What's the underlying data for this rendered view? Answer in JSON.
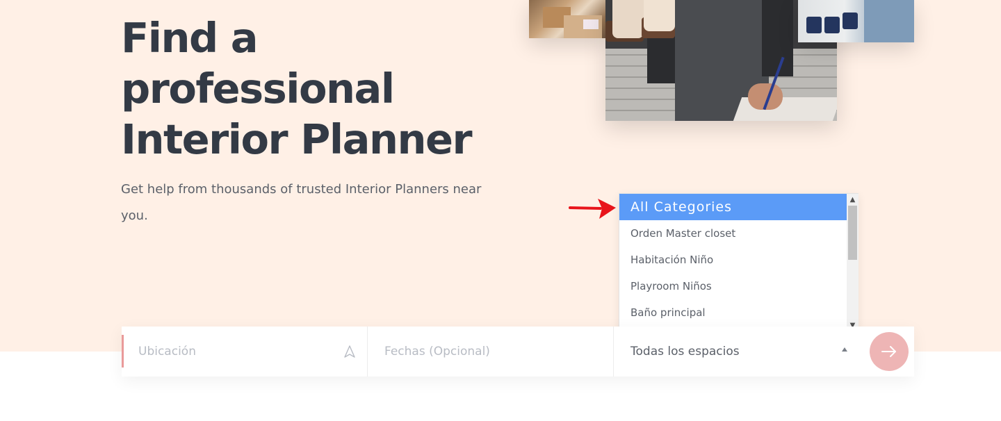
{
  "hero": {
    "title": "Find a professional Interior Planner",
    "subtitle": "Get help from thousands of trusted Interior Planners near you."
  },
  "dropdown": {
    "options": [
      "All Categories",
      "Orden Master closet",
      "Habitación Niño",
      "Playroom Niños",
      "Baño principal"
    ],
    "selected_index": 0,
    "scroll_up_glyph": "▲",
    "scroll_down_glyph": "▼"
  },
  "search": {
    "location_placeholder": "Ubicación",
    "dates_placeholder": "Fechas (Opcional)",
    "space_value": "Todas los espacios",
    "location_icon": "navigation-icon",
    "submit_icon": "arrow-right-icon"
  },
  "colors": {
    "hero_background": "#fff0e6",
    "title_text": "#333a45",
    "dropdown_selected": "#5b9bf7",
    "accent_pink": "#e99a9a",
    "submit_button": "#eeb5b5",
    "annotation_arrow": "#e8141b"
  }
}
